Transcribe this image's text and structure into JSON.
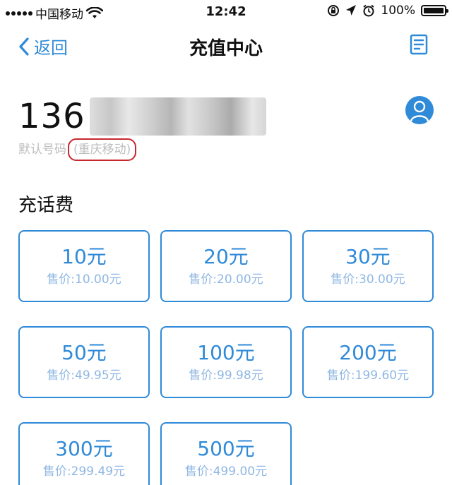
{
  "status_bar": {
    "carrier": "中国移动",
    "time": "12:42",
    "battery": "100%"
  },
  "nav": {
    "back_label": "返回",
    "title": "充值中心"
  },
  "phone": {
    "prefix": "136",
    "label": "默认号码",
    "operator": "(重庆移动)"
  },
  "section": {
    "title": "充话费"
  },
  "options": [
    {
      "amount": "10元",
      "price": "售价:10.00元"
    },
    {
      "amount": "20元",
      "price": "售价:20.00元"
    },
    {
      "amount": "30元",
      "price": "售价:30.00元"
    },
    {
      "amount": "50元",
      "price": "售价:49.95元"
    },
    {
      "amount": "100元",
      "price": "售价:99.98元"
    },
    {
      "amount": "200元",
      "price": "售价:199.60元"
    },
    {
      "amount": "300元",
      "price": "售价:299.49元"
    },
    {
      "amount": "500元",
      "price": "售价:499.00元"
    }
  ],
  "colors": {
    "accent": "#2f8ad8",
    "price_text": "#8fb7e3",
    "highlight_circle": "#c7272e"
  },
  "icons": {
    "back": "chevron-left-icon",
    "records": "document-icon",
    "contact": "person-icon",
    "wifi": "wifi-icon",
    "lock": "rotation-lock-icon",
    "location": "location-arrow-icon",
    "alarm": "alarm-icon",
    "battery": "battery-icon"
  }
}
